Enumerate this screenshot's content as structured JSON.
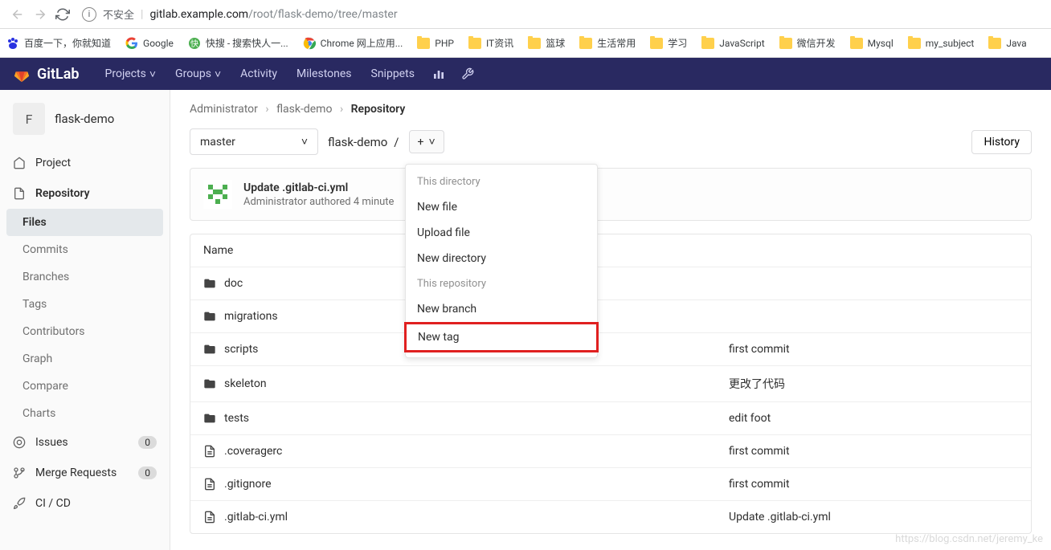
{
  "browser": {
    "security_text": "不安全",
    "url_host": "gitlab.example.com",
    "url_path": "/root/flask-demo/tree/master"
  },
  "bookmarks": [
    {
      "label": "百度一下，你就知道",
      "icon": "baidu"
    },
    {
      "label": "Google",
      "icon": "google"
    },
    {
      "label": "快搜 - 搜索快人一...",
      "icon": "kuai"
    },
    {
      "label": "Chrome 网上应用...",
      "icon": "chrome"
    },
    {
      "label": "PHP",
      "icon": "folder"
    },
    {
      "label": "IT资讯",
      "icon": "folder"
    },
    {
      "label": "篮球",
      "icon": "folder"
    },
    {
      "label": "生活常用",
      "icon": "folder"
    },
    {
      "label": "学习",
      "icon": "folder"
    },
    {
      "label": "JavaScript",
      "icon": "folder"
    },
    {
      "label": "微信开发",
      "icon": "folder"
    },
    {
      "label": "Mysql",
      "icon": "folder"
    },
    {
      "label": "my_subject",
      "icon": "folder"
    },
    {
      "label": "Java",
      "icon": "folder"
    }
  ],
  "topnav": {
    "brand": "GitLab",
    "items": [
      "Projects",
      "Groups",
      "Activity",
      "Milestones",
      "Snippets"
    ]
  },
  "sidebar": {
    "project_initial": "F",
    "project_name": "flask-demo",
    "items": [
      {
        "label": "Project",
        "icon": "home"
      },
      {
        "label": "Repository",
        "icon": "doc",
        "expanded": true,
        "children": [
          {
            "label": "Files",
            "active": true
          },
          {
            "label": "Commits"
          },
          {
            "label": "Branches"
          },
          {
            "label": "Tags"
          },
          {
            "label": "Contributors"
          },
          {
            "label": "Graph"
          },
          {
            "label": "Compare"
          },
          {
            "label": "Charts"
          }
        ]
      },
      {
        "label": "Issues",
        "icon": "issues",
        "badge": "0"
      },
      {
        "label": "Merge Requests",
        "icon": "merge",
        "badge": "0"
      },
      {
        "label": "CI / CD",
        "icon": "rocket"
      }
    ]
  },
  "breadcrumb": {
    "a": "Administrator",
    "b": "flask-demo",
    "c": "Repository"
  },
  "toolbar": {
    "branch": "master",
    "path_root": "flask-demo",
    "history_label": "History"
  },
  "dropdown": {
    "section1": "This directory",
    "items1": [
      "New file",
      "Upload file",
      "New directory"
    ],
    "section2": "This repository",
    "items2": [
      "New branch",
      "New tag"
    ]
  },
  "commit": {
    "title": "Update .gitlab-ci.yml",
    "subtitle": "Administrator authored 4 minute"
  },
  "table": {
    "header_name": "Name",
    "rows": [
      {
        "name": "doc",
        "type": "folder",
        "msg": ""
      },
      {
        "name": "migrations",
        "type": "folder",
        "msg": ""
      },
      {
        "name": "scripts",
        "type": "folder",
        "msg": "first commit"
      },
      {
        "name": "skeleton",
        "type": "folder",
        "msg": "更改了代码"
      },
      {
        "name": "tests",
        "type": "folder",
        "msg": "edit foot"
      },
      {
        "name": ".coveragerc",
        "type": "file",
        "msg": "first commit"
      },
      {
        "name": ".gitignore",
        "type": "file",
        "msg": "first commit"
      },
      {
        "name": ".gitlab-ci.yml",
        "type": "file",
        "msg": "Update .gitlab-ci.yml"
      }
    ]
  },
  "watermark": "https://blog.csdn.net/jeremy_ke"
}
